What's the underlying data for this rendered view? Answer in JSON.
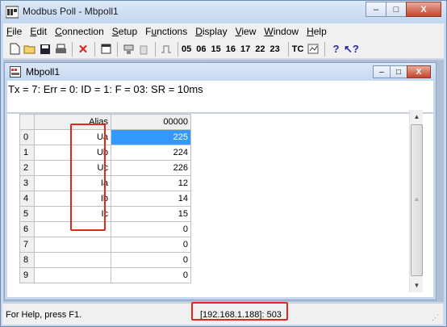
{
  "window": {
    "title": "Modbus Poll - Mbpoll1",
    "minimize": "–",
    "maximize": "□",
    "close": "X"
  },
  "menu": {
    "items": [
      "File",
      "Edit",
      "Connection",
      "Setup",
      "Functions",
      "Display",
      "View",
      "Window",
      "Help"
    ],
    "underlines": [
      "F",
      "E",
      "C",
      "S",
      "u",
      "D",
      "V",
      "W",
      "H"
    ]
  },
  "toolbar": {
    "function_codes": [
      "05",
      "06",
      "15",
      "16",
      "17",
      "22",
      "23"
    ],
    "tc_label": "TC"
  },
  "child": {
    "title": "Mbpoll1",
    "status_line": "Tx = 7: Err = 0: ID = 1: F = 03: SR = 10ms"
  },
  "grid": {
    "col_alias": "Alias",
    "col_value": "00000",
    "rows": [
      {
        "n": "0",
        "alias": "Ua",
        "value": "225"
      },
      {
        "n": "1",
        "alias": "Ub",
        "value": "224"
      },
      {
        "n": "2",
        "alias": "Uc",
        "value": "226"
      },
      {
        "n": "3",
        "alias": "Ia",
        "value": "12"
      },
      {
        "n": "4",
        "alias": "Ib",
        "value": "14"
      },
      {
        "n": "5",
        "alias": "Ic",
        "value": "15"
      },
      {
        "n": "6",
        "alias": "",
        "value": "0"
      },
      {
        "n": "7",
        "alias": "",
        "value": "0"
      },
      {
        "n": "8",
        "alias": "",
        "value": "0"
      },
      {
        "n": "9",
        "alias": "",
        "value": "0"
      }
    ]
  },
  "statusbar": {
    "help": "For Help, press F1.",
    "connection": "[192.168.1.188]: 503"
  },
  "colors": {
    "selection": "#3399ff",
    "highlight_box": "#e0281c"
  }
}
